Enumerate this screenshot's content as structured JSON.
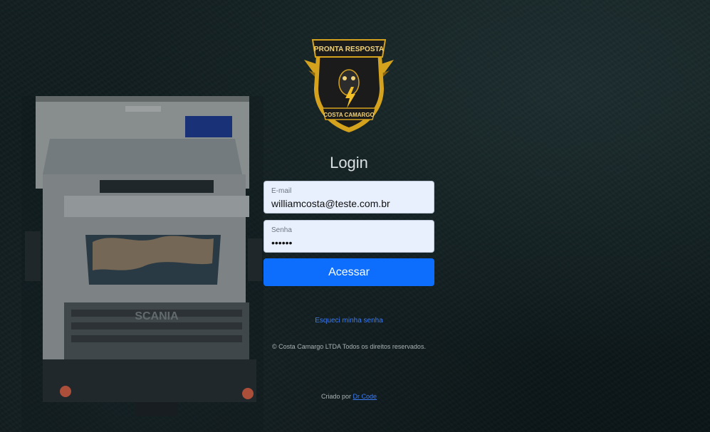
{
  "logo": {
    "top_text": "PRONTA RESPOSTA",
    "bottom_text": "COSTA CAMARGO",
    "colors": {
      "gold": "#d4a21c",
      "dark": "#1b1b1b"
    }
  },
  "form": {
    "title": "Login",
    "email": {
      "label": "E-mail",
      "value": "williamcosta@teste.com.br"
    },
    "password": {
      "label": "Senha",
      "value": "••••••"
    },
    "submit_label": "Acessar"
  },
  "links": {
    "forgot": "Esqueci minha senha",
    "copyright": "© Costa Camargo LTDA Todos os direitos reservados.",
    "created_prefix": "Criado por",
    "creator": "Dr Code"
  },
  "colors": {
    "primary": "#0d6efd",
    "field_bg": "#e8f0fe",
    "page_bg": "#0d1a1c"
  }
}
